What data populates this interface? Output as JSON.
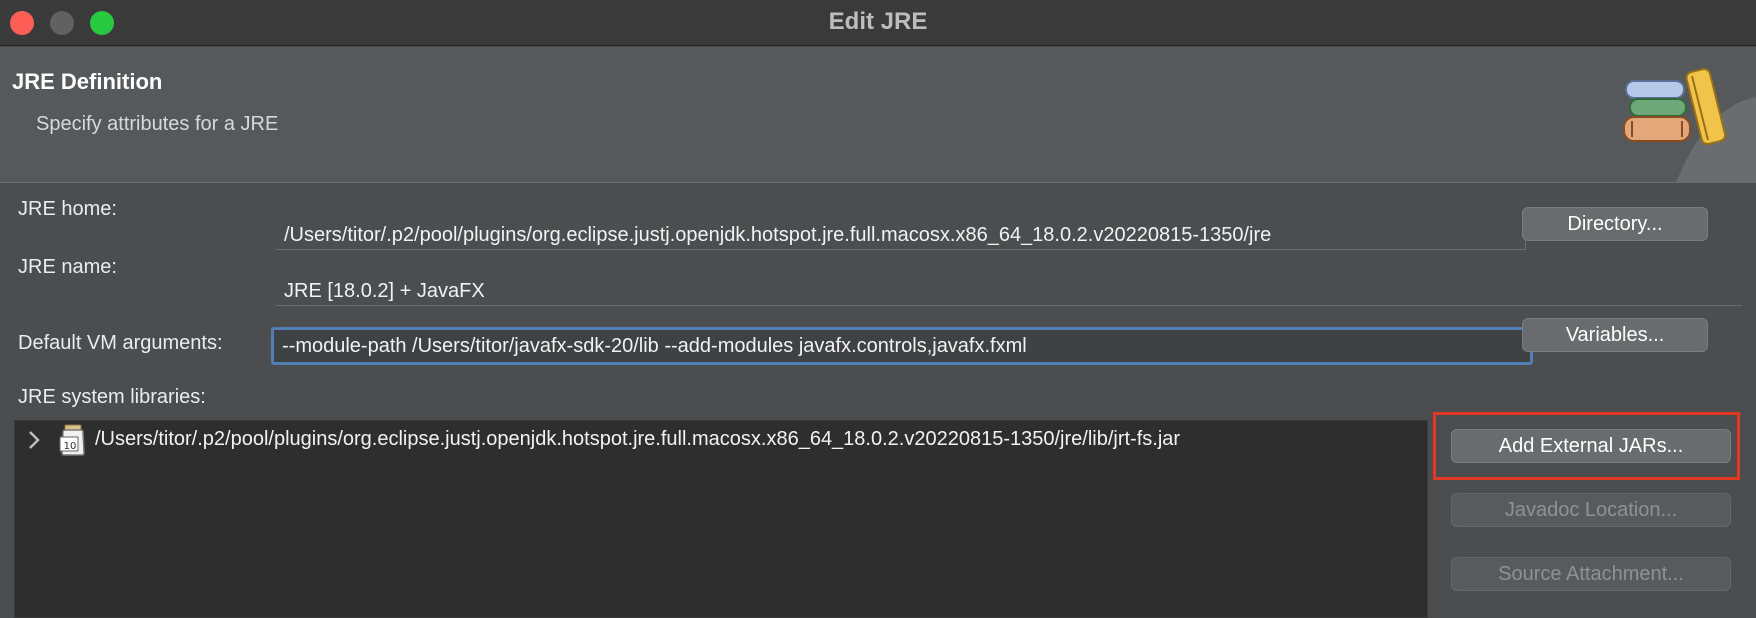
{
  "window": {
    "title": "Edit JRE"
  },
  "banner": {
    "title": "JRE Definition",
    "subtitle": "Specify attributes for a JRE",
    "icon": "jre-books-icon"
  },
  "form": {
    "jre_home": {
      "label": "JRE home:",
      "value": "/Users/titor/.p2/pool/plugins/org.eclipse.justj.openjdk.hotspot.jre.full.macosx.x86_64_18.0.2.v20220815-1350/jre"
    },
    "jre_name": {
      "label": "JRE name:",
      "value": "JRE [18.0.2] + JavaFX"
    },
    "vm_args": {
      "label": "Default VM arguments:",
      "value": "--module-path /Users/titor/javafx-sdk-20/lib --add-modules javafx.controls,javafx.fxml"
    },
    "libraries": {
      "label": "JRE system libraries:"
    }
  },
  "buttons": {
    "directory": "Directory...",
    "variables": "Variables...",
    "add_external_jars": "Add External JARs...",
    "javadoc_location": "Javadoc Location...",
    "source_attachment": "Source Attachment..."
  },
  "libraries": [
    {
      "path": "/Users/titor/.p2/pool/plugins/org.eclipse.justj.openjdk.hotspot.jre.full.macosx.x86_64_18.0.2.v20220815-1350/jre/lib/jrt-fs.jar",
      "icon": "jar-icon",
      "badge": "10"
    }
  ],
  "colors": {
    "highlight": "#e03b22",
    "focus_ring": "#4f7fb4"
  }
}
